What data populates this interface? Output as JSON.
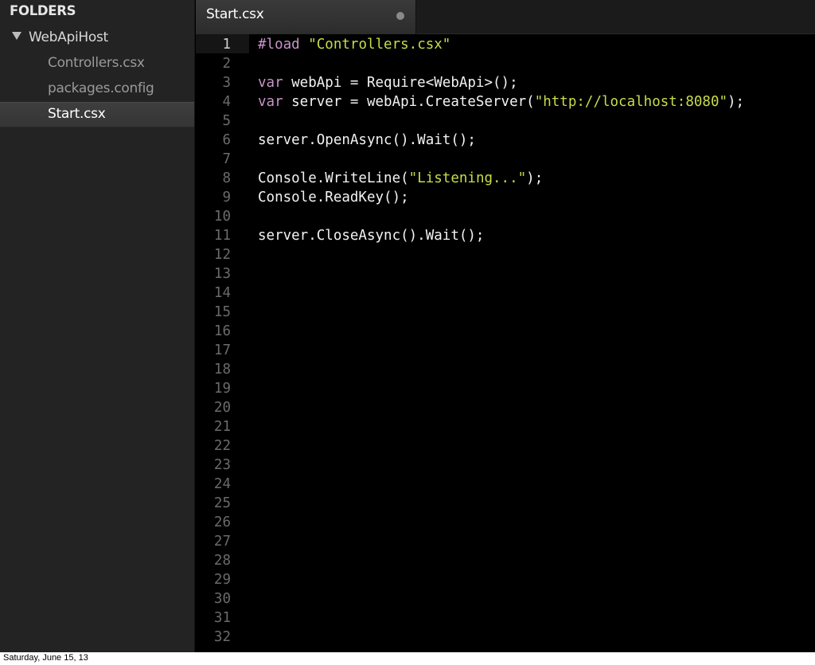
{
  "sidebar": {
    "title": "FOLDERS",
    "folder": {
      "name": "WebApiHost",
      "expanded": true
    },
    "files": [
      {
        "label": "Controllers.csx",
        "selected": false
      },
      {
        "label": "packages.config",
        "selected": false
      },
      {
        "label": "Start.csx",
        "selected": true
      }
    ]
  },
  "tabs": [
    {
      "label": "Start.csx",
      "active": true,
      "modified": true
    }
  ],
  "editor": {
    "current_line": 1,
    "line_numbers": [
      "1",
      "2",
      "3",
      "4",
      "5",
      "6",
      "7",
      "8",
      "9",
      "10",
      "11",
      "12",
      "13",
      "14",
      "15",
      "16",
      "17",
      "18",
      "19",
      "20",
      "21",
      "22",
      "23",
      "24",
      "25",
      "26",
      "27",
      "28",
      "29",
      "30",
      "31",
      "32"
    ],
    "lines": [
      {
        "n": 1,
        "tokens": [
          {
            "t": "#load",
            "k": "kw"
          },
          {
            "t": " ",
            "k": "tx"
          },
          {
            "t": "\"Controllers.csx\"",
            "k": "str"
          }
        ]
      },
      {
        "n": 3,
        "tokens": [
          {
            "t": "var",
            "k": "kw"
          },
          {
            "t": " webApi = Require<WebApi>();",
            "k": "tx"
          }
        ]
      },
      {
        "n": 4,
        "tokens": [
          {
            "t": "var",
            "k": "kw"
          },
          {
            "t": " server = webApi.CreateServer(",
            "k": "tx"
          },
          {
            "t": "\"http://localhost:8080\"",
            "k": "str"
          },
          {
            "t": ");",
            "k": "tx"
          }
        ]
      },
      {
        "n": 6,
        "tokens": [
          {
            "t": "server.OpenAsync().Wait();",
            "k": "tx"
          }
        ]
      },
      {
        "n": 8,
        "tokens": [
          {
            "t": "Console.WriteLine(",
            "k": "tx"
          },
          {
            "t": "\"Listening...\"",
            "k": "str"
          },
          {
            "t": ");",
            "k": "tx"
          }
        ]
      },
      {
        "n": 9,
        "tokens": [
          {
            "t": "Console.ReadKey();",
            "k": "tx"
          }
        ]
      },
      {
        "n": 11,
        "tokens": [
          {
            "t": "server.CloseAsync().Wait();",
            "k": "tx"
          }
        ]
      }
    ]
  },
  "colors": {
    "keyword": "#c794c7",
    "string": "#c8dc4a",
    "text": "#f3f3f3",
    "line_number": "#6b6b6b"
  },
  "icons": {
    "folder_toggle": "triangle-down-icon",
    "tab_modified": "dot-icon"
  },
  "footer": {
    "text": "Saturday, June 15, 13"
  }
}
